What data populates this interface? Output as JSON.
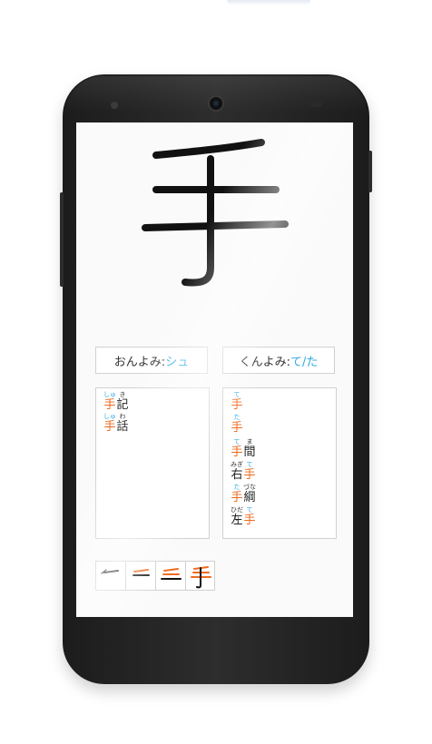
{
  "kanji": "手",
  "on_reading": {
    "label": "おんよみ: ",
    "value": "シュ"
  },
  "kun_reading": {
    "label": "くんよみ: ",
    "value": "て/た"
  },
  "on_words": [
    {
      "furigana": [
        "しゅ",
        "き"
      ],
      "chars": [
        "手",
        "記"
      ]
    },
    {
      "furigana": [
        "しゅ",
        "わ"
      ],
      "chars": [
        "手",
        "話"
      ]
    }
  ],
  "kun_words": [
    {
      "furigana": [
        "て"
      ],
      "chars": [
        "手"
      ]
    },
    {
      "furigana": [
        "た"
      ],
      "chars": [
        "手"
      ]
    },
    {
      "furigana": [
        "て",
        "ま"
      ],
      "chars": [
        "手",
        "間"
      ]
    },
    {
      "furigana": [
        "みぎ",
        "て"
      ],
      "chars": [
        "右",
        "手"
      ]
    },
    {
      "furigana": [
        "た",
        "づな"
      ],
      "chars": [
        "手",
        "綱"
      ]
    },
    {
      "furigana": [
        "ひだり",
        "て"
      ],
      "chars": [
        "左",
        "手"
      ]
    }
  ],
  "stroke_steps": 4,
  "colors": {
    "accent_orange": "#ef6a1e",
    "accent_blue": "#2fa9e4",
    "stroke_black": "#111111"
  },
  "icons": [
    "phone-camera-icon",
    "phone-speaker-icon",
    "phone-sensor-icon"
  ]
}
